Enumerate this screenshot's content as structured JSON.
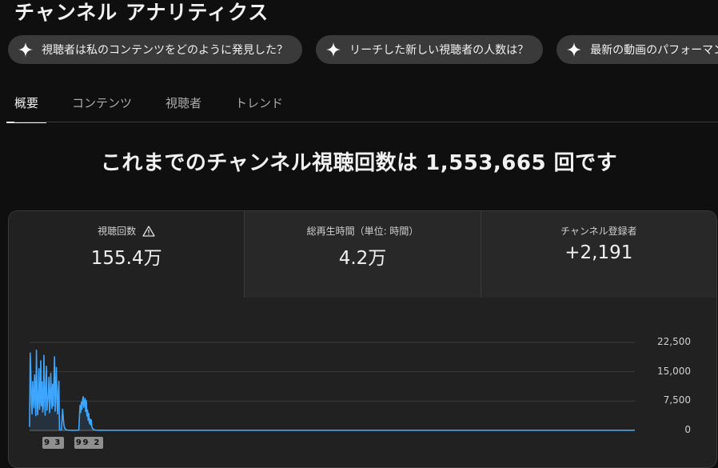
{
  "page": {
    "title": "チャンネル アナリティクス"
  },
  "chips": [
    {
      "label": "視聴者は私のコンテンツをどのように発見した？",
      "icon": "sparkle-icon"
    },
    {
      "label": "リーチした新しい視聴者の人数は？",
      "icon": "sparkle-icon"
    },
    {
      "label": "最新の動画のパフォーマンス",
      "icon": "sparkle-icon"
    }
  ],
  "tabs": [
    {
      "label": "概要",
      "active": true
    },
    {
      "label": "コンテンツ",
      "active": false
    },
    {
      "label": "視聴者",
      "active": false
    },
    {
      "label": "トレンド",
      "active": false
    }
  ],
  "headline": "これまでのチャンネル視聴回数は 1,553,665 回です",
  "metrics": [
    {
      "label": "視聴回数",
      "value": "155.4万",
      "icon": "warning-icon"
    },
    {
      "label": "総再生時間（単位: 時間）",
      "value": "4.2万"
    },
    {
      "label": "チャンネル登録者",
      "value": "+2,191"
    }
  ],
  "chart_data": {
    "type": "line",
    "series": [
      {
        "values": [
          900,
          19800,
          14800,
          6800,
          4200,
          12500,
          8500,
          5800,
          14200,
          10500,
          3800,
          20500,
          8700,
          4000,
          9200,
          15800,
          5400,
          7800,
          17800,
          6300,
          12400,
          4700,
          6200,
          19200,
          9400,
          3900,
          11600,
          16400,
          5200,
          7500,
          8900,
          13600,
          4500,
          6800,
          14600,
          9100,
          5600,
          11800,
          6300,
          12300,
          18800,
          4900,
          10700,
          16100,
          7100,
          4200,
          9800,
          12600,
          200,
          80,
          60,
          150,
          2800,
          5400,
          3200,
          1400,
          800,
          400,
          250,
          150,
          100,
          80,
          60,
          50,
          40,
          30,
          30,
          30,
          30,
          30,
          30,
          30,
          30,
          30,
          30,
          30,
          30,
          30,
          30,
          40,
          3600,
          6400,
          4600,
          7200,
          5400,
          7800,
          8600,
          5900,
          7100,
          8200,
          4800,
          7600,
          3700,
          5200,
          2600,
          4300,
          1800,
          2900,
          1400,
          2700,
          900,
          500,
          300,
          200,
          150,
          100,
          80,
          60,
          50,
          40,
          30,
          30,
          30,
          30,
          30,
          30,
          30,
          30,
          30,
          30,
          30,
          30,
          30,
          30,
          30,
          30,
          30,
          30,
          30,
          30,
          30,
          30,
          30,
          30,
          30,
          30,
          30,
          30,
          30,
          30,
          30,
          30,
          30,
          30,
          30,
          30,
          30,
          30,
          30,
          30,
          30,
          30,
          30,
          30,
          30,
          30,
          30,
          30,
          30,
          30,
          30,
          30,
          30,
          30,
          30,
          30,
          30,
          30,
          30,
          30,
          30,
          30,
          30,
          30,
          30,
          30,
          30,
          30,
          30,
          30,
          30,
          30,
          30,
          30,
          30,
          30,
          30,
          30,
          30,
          30,
          30,
          30,
          30,
          30,
          30,
          30,
          30,
          30,
          30,
          30,
          30,
          30,
          30,
          30,
          30,
          30,
          30,
          30,
          30,
          30,
          30,
          30,
          30,
          30,
          30,
          30,
          30,
          30,
          30,
          30,
          30,
          30,
          30,
          30,
          30,
          30,
          30,
          30,
          30,
          30,
          30,
          30,
          30,
          30,
          30,
          30,
          30,
          30,
          30,
          30,
          30,
          30,
          30,
          30,
          30,
          30,
          30,
          30,
          30,
          30,
          30,
          30,
          30,
          30,
          30,
          30,
          30,
          30,
          30,
          30,
          30,
          30,
          30,
          30,
          30,
          30,
          30,
          30,
          30,
          30,
          30,
          30,
          30,
          30,
          30,
          30,
          30,
          30,
          30,
          30,
          30,
          30,
          30,
          30,
          30,
          30,
          30,
          30,
          30,
          30,
          30,
          30,
          30,
          30,
          30,
          30,
          30,
          30,
          30,
          30,
          30,
          30,
          30,
          30,
          30,
          30,
          30,
          30,
          30,
          30,
          30,
          30,
          30,
          30,
          30,
          30,
          30,
          30,
          30,
          30,
          30,
          30,
          30,
          30,
          30,
          30,
          30,
          30,
          30,
          30,
          30,
          30,
          30,
          30,
          30,
          30,
          30,
          30,
          30,
          30,
          30,
          30,
          30,
          30,
          30,
          30,
          30,
          30,
          30,
          30,
          30,
          30,
          30,
          30,
          30,
          30,
          30,
          30,
          30,
          30,
          30,
          30,
          30,
          30,
          30,
          30,
          30,
          30,
          30,
          30,
          30,
          30,
          30,
          30,
          30,
          30,
          30,
          30,
          30,
          30,
          30,
          30,
          30,
          30,
          30,
          30,
          30,
          30,
          30,
          30,
          30,
          30,
          30,
          30,
          30,
          30,
          30,
          30,
          30,
          30,
          30,
          30,
          30,
          30,
          30,
          30,
          30,
          30,
          30,
          30,
          30,
          30,
          30,
          30,
          30,
          30,
          30,
          30,
          30,
          30,
          30,
          30,
          30,
          30,
          30,
          30,
          30,
          30,
          30,
          30,
          30,
          30,
          30,
          30,
          30,
          30,
          30,
          30,
          30,
          30,
          30,
          30,
          30,
          30,
          30,
          30,
          30,
          30,
          30,
          30,
          30,
          30,
          30,
          30,
          30,
          30,
          30,
          30,
          30,
          30,
          30,
          30,
          30,
          30,
          30,
          30,
          30,
          30,
          30,
          30,
          30,
          30,
          30,
          30,
          30,
          30,
          30,
          30,
          30,
          30,
          30,
          30,
          30,
          30,
          30,
          30,
          30,
          30,
          30,
          30,
          30,
          30,
          30,
          30,
          30,
          30,
          30,
          30,
          30,
          30,
          30,
          30,
          30,
          30,
          30,
          30,
          30,
          30,
          30,
          30,
          30,
          30,
          30,
          30,
          30,
          30,
          30,
          30,
          30,
          30,
          30,
          30,
          30,
          30,
          30,
          30,
          30,
          30,
          30,
          30,
          30,
          30,
          30,
          30,
          30,
          30,
          30,
          30,
          30,
          30,
          30,
          30,
          30,
          30,
          30,
          30,
          30,
          30,
          30,
          30,
          30,
          30,
          30,
          30,
          30,
          30,
          30,
          30,
          30,
          30,
          30,
          30,
          30,
          30,
          30,
          30,
          30,
          30,
          30,
          30,
          30,
          30,
          30,
          30,
          30,
          30,
          30,
          30,
          30,
          30,
          30,
          30,
          30,
          30,
          30,
          30,
          30,
          30,
          30,
          30,
          30,
          30,
          30,
          30,
          30,
          30,
          30,
          30,
          30,
          30,
          30,
          30,
          30,
          30,
          30,
          30,
          30,
          30,
          30,
          30,
          30,
          30,
          30,
          30,
          30,
          30,
          30,
          30,
          30,
          30,
          30,
          30,
          30,
          30,
          30,
          30,
          30,
          30,
          30,
          30,
          30,
          30,
          30,
          30,
          30,
          30,
          30,
          30,
          30,
          30,
          30,
          30,
          30,
          30,
          30,
          30,
          30,
          30,
          30,
          30,
          30,
          30,
          30,
          30,
          30,
          30,
          30,
          30,
          30,
          30,
          30,
          30,
          30,
          30,
          30,
          30,
          30,
          30,
          30,
          30,
          30,
          30,
          30,
          30,
          30,
          30,
          30,
          30,
          30,
          30,
          30,
          30,
          30,
          30,
          30,
          30,
          30,
          30,
          30,
          30,
          30,
          30,
          30,
          30,
          30,
          30,
          30,
          30,
          30,
          30,
          30,
          30,
          30,
          30,
          30,
          30,
          30,
          30,
          30,
          30,
          30,
          30,
          30,
          30,
          30,
          30,
          30,
          30,
          30,
          30,
          30,
          30,
          30,
          30,
          30,
          30,
          30,
          30,
          30,
          30,
          30,
          30,
          30,
          30,
          30,
          30,
          30,
          30,
          30,
          30,
          30,
          30,
          30,
          30,
          30,
          30,
          30,
          30,
          30,
          30,
          30,
          30,
          30,
          30,
          30,
          30,
          30,
          30,
          30,
          30,
          30,
          30,
          30,
          30,
          30,
          30,
          30,
          30,
          30,
          30,
          30,
          30,
          30,
          30,
          30,
          30,
          30,
          30,
          30,
          30,
          30,
          30,
          30,
          30,
          30,
          30,
          30,
          30,
          30,
          30,
          30,
          30,
          30,
          30,
          30,
          30,
          30,
          30,
          30,
          30,
          30,
          30,
          30,
          30,
          30,
          30,
          30,
          30,
          30,
          30,
          30,
          30,
          30,
          30,
          30,
          30,
          30,
          30,
          30,
          30,
          30,
          30,
          30,
          30,
          30,
          30,
          30,
          30,
          30,
          30,
          30,
          30,
          30,
          30,
          30,
          30,
          30,
          30,
          30,
          30,
          30,
          30,
          30,
          30,
          30,
          30,
          30,
          30,
          30,
          30,
          30,
          30,
          30,
          30,
          30,
          30,
          30,
          30,
          30,
          30,
          30,
          30,
          30,
          30,
          30,
          30,
          30,
          30,
          30,
          30,
          30,
          30,
          30,
          30,
          30,
          30,
          30,
          30,
          30,
          30,
          30,
          30,
          30,
          30,
          30,
          30,
          30,
          30,
          30,
          30,
          30,
          30,
          30,
          30,
          30,
          30,
          30,
          30,
          30,
          30,
          30,
          30,
          30,
          30,
          30,
          30,
          30,
          30,
          30,
          30,
          30,
          30,
          30,
          30,
          30,
          30,
          30,
          30,
          30,
          30,
          30,
          30,
          30,
          30,
          30,
          30,
          30,
          30,
          30,
          30,
          30,
          30,
          30,
          30,
          30,
          30,
          30,
          30,
          30,
          30,
          30,
          30,
          30,
          30,
          30,
          30,
          30,
          30,
          30,
          30,
          30,
          30,
          30,
          30,
          30,
          30,
          30,
          30,
          30,
          30,
          30,
          30,
          30,
          30,
          30,
          30,
          30,
          30,
          30,
          30,
          30,
          30
        ]
      }
    ],
    "y_ticks": [
      "22,500",
      "15,000",
      "7,500",
      "0"
    ],
    "y_tick_values": [
      22500,
      15000,
      7500,
      0
    ],
    "ylim": [
      0,
      22500
    ],
    "grid": true,
    "line_color": "#3ea6ff",
    "markers": [
      {
        "label": "9+",
        "index": 31
      },
      {
        "label": "3",
        "index": 44
      },
      {
        "label": "9+",
        "index": 82
      },
      {
        "label": "9+",
        "index": 93
      },
      {
        "label": "2",
        "index": 107
      }
    ]
  }
}
